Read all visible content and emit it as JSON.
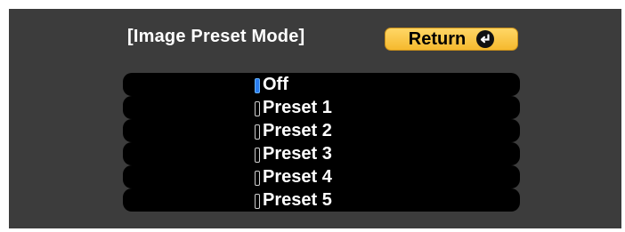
{
  "menu": {
    "title": "[Image Preset Mode]",
    "return_label": "Return",
    "options": [
      {
        "label": "Off",
        "selected": true
      },
      {
        "label": "Preset 1",
        "selected": false
      },
      {
        "label": "Preset 2",
        "selected": false
      },
      {
        "label": "Preset 3",
        "selected": false
      },
      {
        "label": "Preset 4",
        "selected": false
      },
      {
        "label": "Preset 5",
        "selected": false
      }
    ]
  },
  "icons": {
    "return": "enter-icon"
  },
  "colors": {
    "background": "#3c3c3c",
    "button": "#f5b92e",
    "selected": "#2a7cf0"
  }
}
